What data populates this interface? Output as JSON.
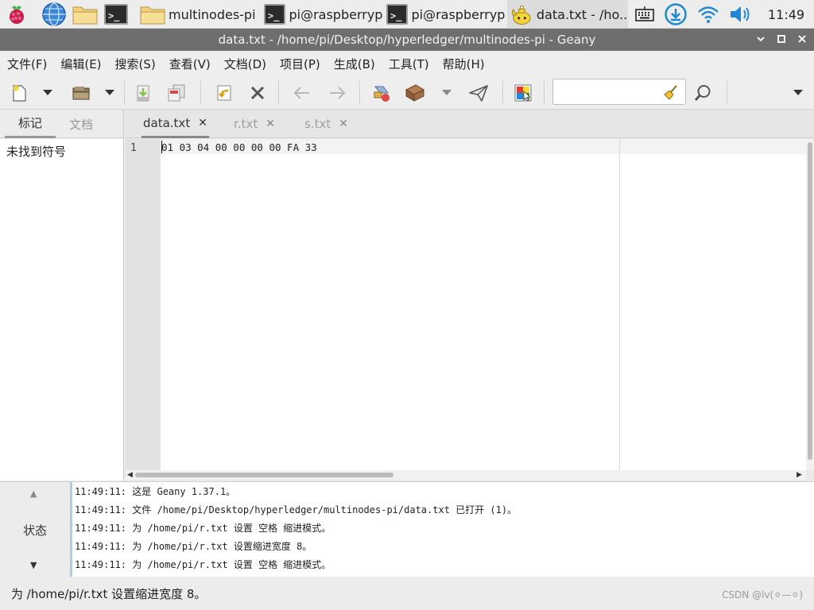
{
  "taskbar": {
    "tasks": [
      {
        "label": "multinodes-pi",
        "icon": "folder-icon"
      },
      {
        "label": "pi@raspberryp...",
        "icon": "terminal-icon"
      },
      {
        "label": "pi@raspberryp...",
        "icon": "terminal-icon"
      },
      {
        "label": "data.txt - /ho...",
        "icon": "geany-icon",
        "active": true
      }
    ],
    "clock": "11:49"
  },
  "window": {
    "title": "data.txt - /home/pi/Desktop/hyperledger/multinodes-pi - Geany"
  },
  "menubar": {
    "items": [
      "文件(F)",
      "编辑(E)",
      "搜索(S)",
      "查看(V)",
      "文档(D)",
      "项目(P)",
      "生成(B)",
      "工具(T)",
      "帮助(H)"
    ]
  },
  "toolbar": {
    "search_value": ""
  },
  "sidebar": {
    "tabs": [
      "标记",
      "文档"
    ],
    "active_tab": 0,
    "message": "未找到符号"
  },
  "editor": {
    "tabs": [
      {
        "name": "data.txt",
        "active": true
      },
      {
        "name": "r.txt",
        "active": false
      },
      {
        "name": "s.txt",
        "active": false
      }
    ],
    "lines": [
      {
        "number": "1",
        "text": "01 03 04 00 00 00 00 FA 33"
      }
    ]
  },
  "messages": {
    "tab_label": "状态",
    "lines": [
      "11:49:11: 这是 Geany 1.37.1。",
      "11:49:11: 文件 /home/pi/Desktop/hyperledger/multinodes-pi/data.txt 已打开 (1)。",
      "11:49:11: 为 /home/pi/r.txt 设置 空格 缩进模式。",
      "11:49:11: 为 /home/pi/r.txt 设置缩进宽度 8。",
      "11:49:11: 为 /home/pi/r.txt 设置 空格 缩进模式。"
    ]
  },
  "statusbar": {
    "text": "为 /home/pi/r.txt 设置缩进宽度 8。",
    "watermark": "CSDN @lv(⚪—⚪)"
  },
  "colors": {
    "titlebar": "#6e6e6e",
    "taskbar_icon_blue": "#1e88d2",
    "raspberry_red": "#c51a4a"
  }
}
